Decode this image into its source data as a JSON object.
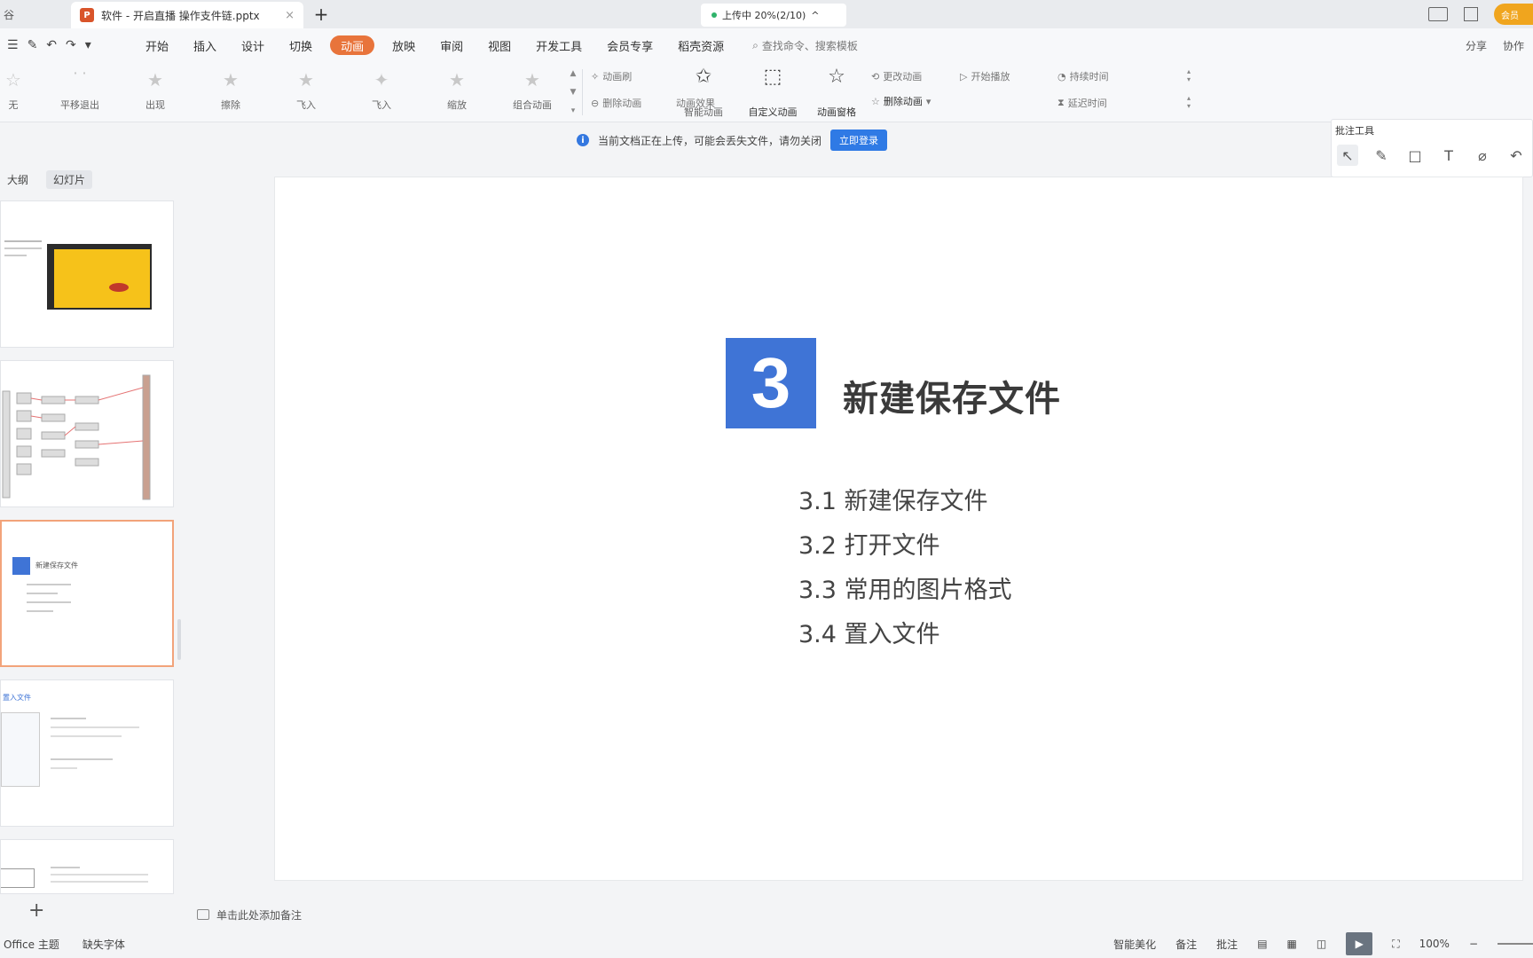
{
  "titlebar": {
    "left_stub": "谷",
    "doc_tab": {
      "icon_text": "P",
      "name": "软件 - 开启直播 操作支件链.pptx",
      "close": "×"
    },
    "new_tab": "+",
    "sync_status": "上传中 20%(2/10)",
    "sync_chevron": "^",
    "member": "会员"
  },
  "menubar": {
    "tools": [
      "☰",
      "✎",
      "↶",
      "↷",
      "▾"
    ],
    "items": [
      "开始",
      "插入",
      "设计",
      "切换",
      "动画",
      "放映",
      "审阅",
      "视图",
      "开发工具",
      "会员专享",
      "稻壳资源"
    ],
    "active_index": 4,
    "search_icon": "⌕",
    "search_placeholder": "查找命令、搜索模板",
    "right_items": [
      "分享",
      "协作"
    ]
  },
  "ribbon": {
    "effects": [
      {
        "label": "无"
      },
      {
        "label": "平移退出"
      },
      {
        "label": "出现"
      },
      {
        "label": "擦除"
      },
      {
        "label": "飞入"
      },
      {
        "label": "飞入"
      },
      {
        "label": "缩放"
      },
      {
        "label": "组合动画"
      }
    ],
    "small_buttons": [
      "动画刷",
      "删除动画",
      "动画效果",
      "自定义动画",
      "动画窗格",
      "更改动画",
      "开始播放",
      "持续时间",
      "延迟时间"
    ],
    "big_buttons": [
      "智能动画",
      "动画窗格"
    ],
    "remove_anim": "删除动画",
    "anim_effect_small": "动画效果"
  },
  "notice": {
    "text": "当前文档正在上传，可能会丢失文件，请勿关闭",
    "button": "立即登录",
    "icon": "i"
  },
  "pen_panel": {
    "title": "批注工具",
    "tools": [
      "↖",
      "✎",
      "□",
      "T",
      "⌀",
      "↶"
    ]
  },
  "left_pane": {
    "view_tabs": [
      "大纲",
      "幻灯片"
    ],
    "thumb3_title": "新建保存文件",
    "thumb4_title": "置入文件",
    "add": "+"
  },
  "slide": {
    "number": "3",
    "title": "新建保存文件",
    "items": [
      "3.1 新建保存文件",
      "3.2 打开文件",
      "3.3 常用的图片格式",
      "3.4 置入文件"
    ],
    "accent": "#3f74d6"
  },
  "notes": {
    "placeholder": "单击此处添加备注"
  },
  "statusbar": {
    "left": [
      "Office 主题",
      "缺失字体"
    ],
    "right": [
      "智能美化",
      "备注",
      "批注"
    ],
    "zoom": "100%"
  }
}
